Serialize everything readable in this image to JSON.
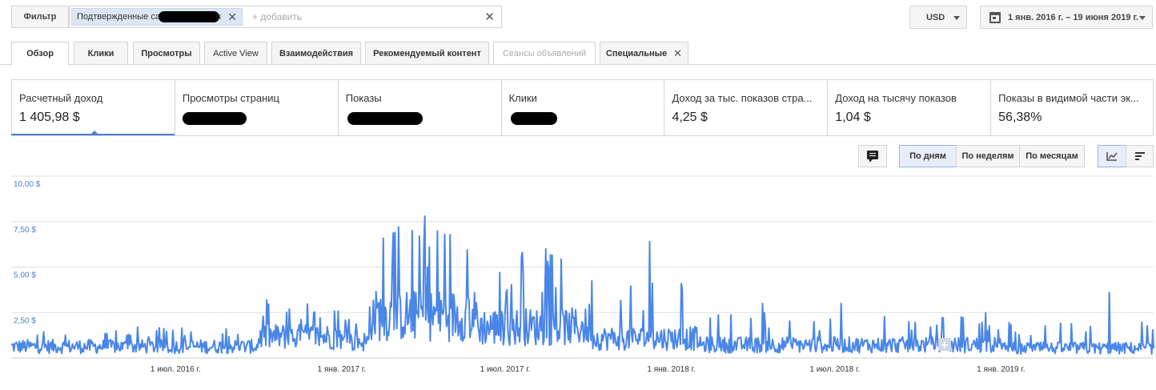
{
  "filter": {
    "button_label": "Фильтр",
    "chip_label": "Подтвержденные са",
    "chip_tail": "u",
    "add_placeholder": "+ добавить"
  },
  "currency": {
    "label": "USD"
  },
  "date_range": {
    "label": "1 янв. 2016 г. – 19 июня 2019 г."
  },
  "tabs": [
    {
      "label": "Обзор"
    },
    {
      "label": "Клики"
    },
    {
      "label": "Просмотры"
    },
    {
      "label": "Active View"
    },
    {
      "label": "Взаимодействия"
    },
    {
      "label": "Рекомендуемый контент"
    },
    {
      "label": "Сеансы объявлений"
    },
    {
      "label": "Специальные"
    }
  ],
  "metrics": [
    {
      "label": "Расчетный доход",
      "value": "1 405,98 $"
    },
    {
      "label": "Просмотры страниц",
      "value": ""
    },
    {
      "label": "Показы",
      "value": ""
    },
    {
      "label": "Клики",
      "value": ""
    },
    {
      "label": "Доход за тыс. показов стра...",
      "value": "4,25 $"
    },
    {
      "label": "Доход на тысячу показов",
      "value": "1,04 $"
    },
    {
      "label": "Показы в видимой части эк...",
      "value": "56,38%"
    }
  ],
  "granularity": {
    "day": "По дням",
    "week": "По неделям",
    "month": "По месяцам",
    "selected": "day"
  },
  "chart_data": {
    "type": "line",
    "series": [
      {
        "color": "#4a86e8"
      }
    ],
    "ytick_labels": [
      "2,50 $",
      "5,00 $",
      "7,50 $",
      "10,00 $"
    ],
    "ytick_values": [
      2.5,
      5.0,
      7.5,
      10.0
    ],
    "ylim": [
      0,
      10
    ],
    "xtick_labels": [
      "1 июл. 2016 г.",
      "1 янв. 2017 г.",
      "1 июл. 2017 г.",
      "1 янв. 2018 г.",
      "1 июл. 2018 г.",
      "1 янв. 2019 г."
    ],
    "xtick_dates": [
      "2016-07-01",
      "2017-01-01",
      "2017-07-01",
      "2018-01-01",
      "2018-07-01",
      "2019-01-01"
    ],
    "x_range": [
      "2016-01-01",
      "2019-06-19"
    ],
    "grid": true,
    "legend": "none",
    "periods": [
      {
        "from": "2016-01-01",
        "to": "2016-09-30",
        "typical": 0.7,
        "spike": 1.7
      },
      {
        "from": "2016-10-01",
        "to": "2016-12-31",
        "typical": 1.3,
        "spike": 3.0
      },
      {
        "from": "2017-01-01",
        "to": "2017-01-31",
        "typical": 1.0,
        "spike": 2.5
      },
      {
        "from": "2017-02-01",
        "to": "2017-05-31",
        "typical": 2.6,
        "spike": 7.2
      },
      {
        "from": "2017-06-01",
        "to": "2017-09-30",
        "typical": 1.9,
        "spike": 5.8
      },
      {
        "from": "2017-10-01",
        "to": "2018-01-31",
        "typical": 1.2,
        "spike": 4.6
      },
      {
        "from": "2018-02-01",
        "to": "2018-12-31",
        "typical": 0.8,
        "spike": 2.5
      },
      {
        "from": "2019-01-01",
        "to": "2019-06-19",
        "typical": 0.6,
        "spike": 2.0
      }
    ],
    "peaks": [
      {
        "date": "2017-04-03",
        "value": 7.8
      },
      {
        "date": "2017-03-05",
        "value": 7.2
      },
      {
        "date": "2017-03-20",
        "value": 7.0
      },
      {
        "date": "2017-04-25",
        "value": 6.8
      },
      {
        "date": "2017-03-28",
        "value": 6.7
      },
      {
        "date": "2017-07-20",
        "value": 5.8
      },
      {
        "date": "2017-12-08",
        "value": 6.4
      },
      {
        "date": "2017-08-15",
        "value": 6.0
      },
      {
        "date": "2019-05-01",
        "value": 3.6
      },
      {
        "date": "2018-07-08",
        "value": 3.0
      },
      {
        "date": "2018-04-12",
        "value": 3.0
      },
      {
        "date": "2016-10-10",
        "value": 3.2
      }
    ]
  }
}
